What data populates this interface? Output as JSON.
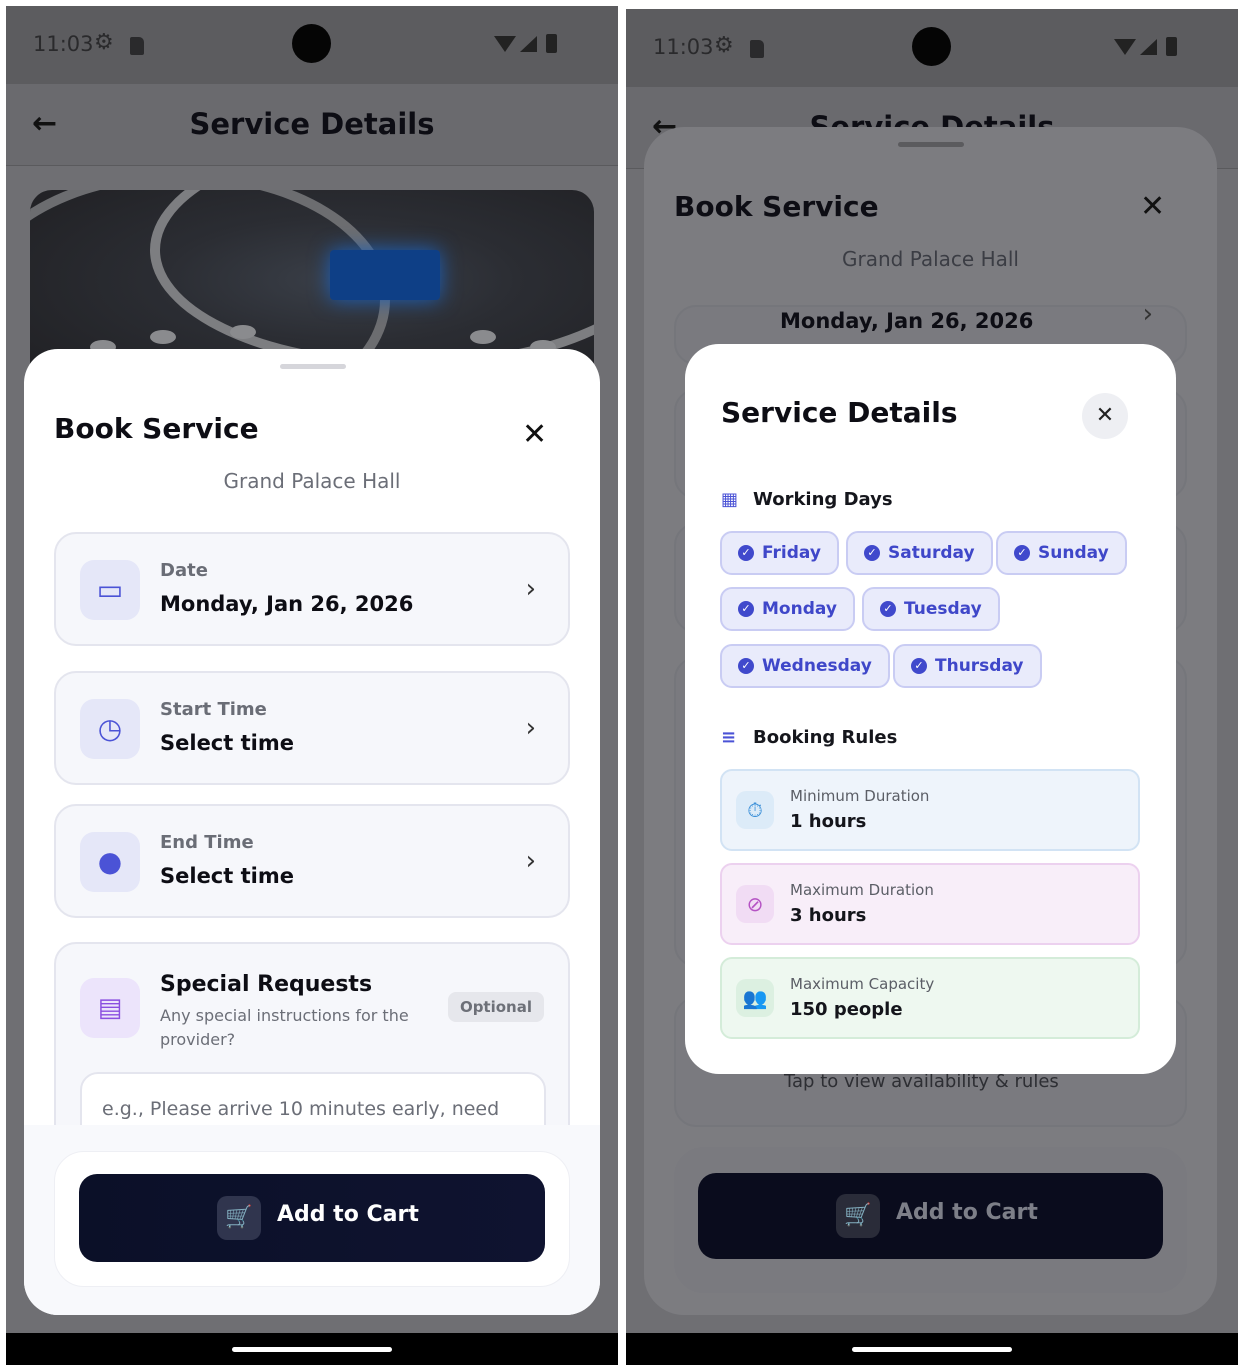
{
  "status": {
    "time": "11:03"
  },
  "left": {
    "appbar": {
      "title": "Service Details"
    },
    "sheet": {
      "title": "Book Service",
      "subtitle": "Grand Palace Hall",
      "date": {
        "label": "Date",
        "value": "Monday, Jan 26, 2026"
      },
      "start_time": {
        "label": "Start Time",
        "value": "Select time"
      },
      "end_time": {
        "label": "End Time",
        "value": "Select time"
      },
      "special_requests": {
        "title": "Special Requests",
        "description": "Any special instructions for the provider?",
        "badge": "Optional",
        "placeholder": "e.g., Please arrive 10 minutes early, need"
      },
      "cart_button": "Add to Cart"
    }
  },
  "right": {
    "appbar": {
      "title": "Service Details"
    },
    "sheet": {
      "title": "Book Service",
      "subtitle": "Grand Palace Hall",
      "date_value": "Monday, Jan 26, 2026",
      "hint": "Tap to view availability & rules",
      "cart_button": "Add to Cart"
    },
    "modal": {
      "title": "Service Details",
      "working_days_heading": "Working Days",
      "working_days": [
        "Friday",
        "Saturday",
        "Sunday",
        "Monday",
        "Tuesday",
        "Wednesday",
        "Thursday"
      ],
      "booking_rules_heading": "Booking Rules",
      "rules": [
        {
          "label": "Minimum Duration",
          "value": "1 hours",
          "icon": "stopwatch-icon",
          "accent": "#3a8fd8"
        },
        {
          "label": "Maximum Duration",
          "value": "3 hours",
          "icon": "timer-off-icon",
          "accent": "#b552c4"
        },
        {
          "label": "Maximum Capacity",
          "value": "150 people",
          "icon": "people-icon",
          "accent": "#3fa35a"
        }
      ]
    }
  },
  "colors": {
    "primary": "#4b53d6",
    "button_dark": "#0b1028",
    "chip_bg": "#e9ebfb"
  }
}
